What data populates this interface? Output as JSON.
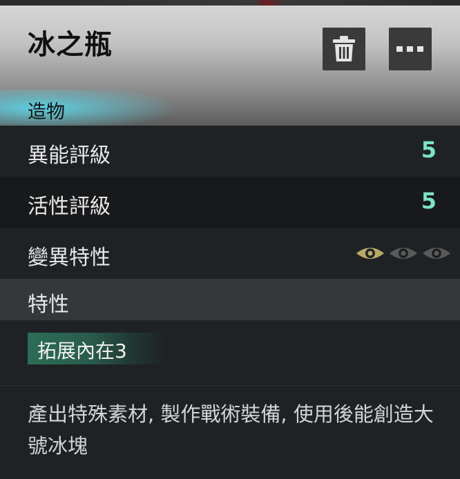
{
  "item": {
    "title": "冰之瓶",
    "category": "造物"
  },
  "toolbar": {
    "delete_icon": "trash-icon",
    "more_icon": "more-options-icon"
  },
  "stats": [
    {
      "label": "異能評級",
      "value": "5"
    },
    {
      "label": "活性評級",
      "value": "5"
    },
    {
      "label": "變異特性",
      "mutation_levels": {
        "total": 3,
        "active": 1
      }
    }
  ],
  "traits_section": {
    "label": "特性",
    "trait": "拓展內在3"
  },
  "description": "產出特殊素材, 製作戰術裝備, 使用後能創造大號冰塊",
  "colors": {
    "value_accent": "#7ce3c3",
    "category_glow": "#5cd6e8",
    "active_eye": "#b9a968",
    "inactive_eye": "#5a5a5a"
  }
}
